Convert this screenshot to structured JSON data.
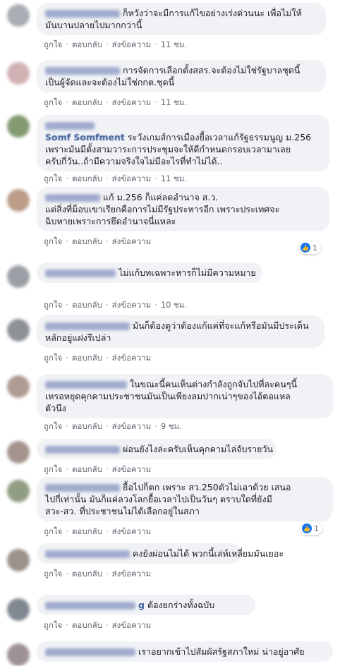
{
  "actions": {
    "like": "ถูกใจ",
    "reply": "ตอบกลับ",
    "message": "ส่งข้อความ"
  },
  "comments": [
    {
      "name_visible": "",
      "text_lines": [
        "ก็หวังว่าจะมีการแก้ไขอย่างเร่งด่วนนะ เพื่อไม่ให้",
        "มันบานปลายไปมากกว่านี้"
      ],
      "time": "11 ชม.",
      "avatar_color": "#9aa0a6"
    },
    {
      "name_visible": "",
      "text_lines": [
        "การจัดการเลือกตั้งสสร.จะต้องไม่ใช่รัฐบาลชุดนี้",
        "เป็นผู้จัดและจะต้องไม่ใช่กกต.ชุดนี้"
      ],
      "time": "11 ชม.",
      "avatar_color": "#c9a5a8"
    },
    {
      "name_visible": "Somf Somfment",
      "text_lines": [
        "ระวังเกมส์การเมืองยื้อเวลาแก้รัฐธรรมนูญ ม.256",
        "เพราะมันมีตั้งสามวาระการประชุมจะให้ดีกำหนดกรอบเวลามาเลย",
        "ครับกี่วัน..ถ้ามีความจริงใจไม่มีอะไรที่ทำไม่ได้.."
      ],
      "time": "11 ชม.",
      "avatar_color": "#6f8a5a"
    },
    {
      "name_visible": "",
      "text_lines": [
        "แก้ ม.256 ก็แค่ลดอำนาจ ส.ว.",
        "แต่สิ่งที่ม็อบเขาเรียกคือการไม่มีรัฐประหารอีก เพราะประเทศจะ",
        "ฉิบหายเพราะการยึดอำนาจนี่แหละ"
      ],
      "time": "",
      "reaction_count": "1",
      "avatar_color": "#b08c74"
    },
    {
      "name_visible": "",
      "text_lines": [
        "ไม่แก้บทเฉพาะหารก็ไม่มีความหมาย"
      ],
      "time": "10 ชม.",
      "avatar_color": "#8b8f96"
    },
    {
      "name_visible": "",
      "text_lines": [
        "มันก็ต้องดูว่าต้องแก้แค่ที่จะแก้หรือมันมีประเด็น",
        "หลักอยู่แฝงรึเปล่า"
      ],
      "time": "",
      "avatar_color": "#7a7f85"
    },
    {
      "name_visible": "",
      "text_lines": [
        "ในขณะนี้คนเห็นต่างกำลังถูกจับไปที่ละคนๆนี้",
        "เหรอหยุดคุกคามประชาชนมันเป็นเพียงลมปากเน่าๆของไอ้ตอแหล",
        "ตัวนึง"
      ],
      "time": "9 ชม.",
      "avatar_color": "#a08a7e"
    },
    {
      "name_visible": "",
      "text_lines": [
        "ผ่อนยังไงล่ะครับเห็นคุกคามไล่จับรายวัน"
      ],
      "time": "",
      "avatar_color": "#95807a"
    },
    {
      "name_visible": "",
      "text_lines": [
        "ยื้อไปก็ตก เพราะ สว.250ตัวไม่เอาด้วย เสนอ",
        "ไปกี่เท่านั้น มันก็แค่ลวงโลกยื้อเวลาไปเป็นวันๆ ตราบใดที่ยังมี",
        "สวะ-สว. ที่ประชาชนไม่ได้เลือกอยู่ในสภา"
      ],
      "time": "",
      "reaction_count": "1",
      "avatar_color": "#7e8c6e"
    },
    {
      "name_visible": "",
      "text_lines": [
        "คงยังผ่อนไม่ได้ พวกนี้เล่ห์เหลี่ยมมันเยอะ"
      ],
      "time": "",
      "avatar_color": "#8a8078"
    },
    {
      "name_visible": "g",
      "text_lines": [
        "ต้องยกร่างทั้งฉบับ"
      ],
      "time": "",
      "avatar_color": "#6c7480"
    },
    {
      "name_visible": "",
      "text_lines": [
        "เราอยากเข้าไปสัมผัสรัฐสภาใหม่ น่าอยู่อาศัย"
      ],
      "time": "",
      "avatar_color": "#8f7f86"
    }
  ]
}
